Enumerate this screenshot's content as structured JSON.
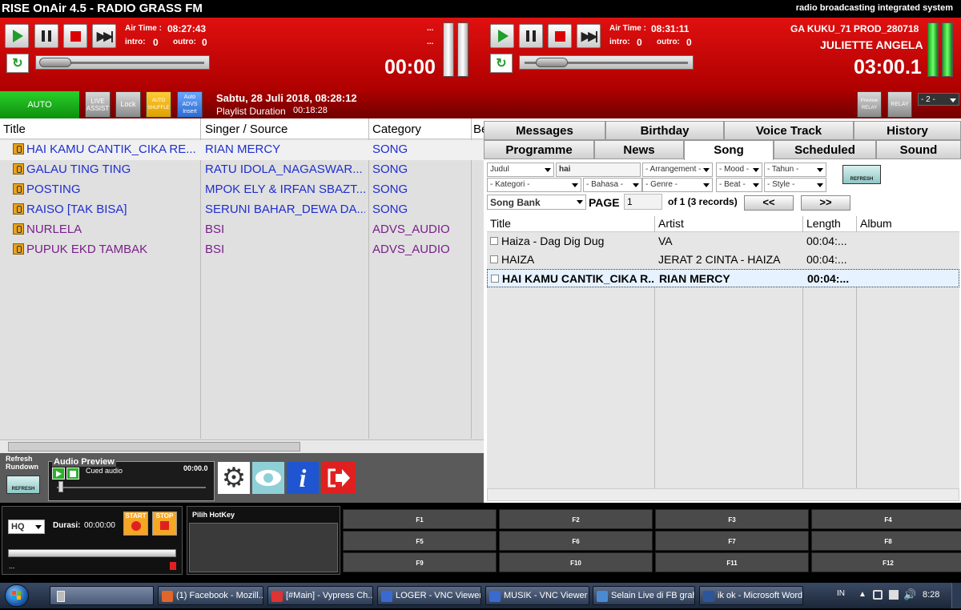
{
  "app": {
    "title": "RISE OnAir 4.5 - RADIO GRASS FM",
    "tagline": "radio broadcasting integrated system"
  },
  "player1": {
    "air_time_label": "Air Time :",
    "air_time": "08:27:43",
    "intro_label": "intro:",
    "intro": "0",
    "outro_label": "outro:",
    "outro": "0",
    "dots1": "...",
    "dots2": "...",
    "time": "00:00"
  },
  "player2": {
    "air_time_label": "Air Time :",
    "air_time": "08:31:11",
    "intro_label": "intro:",
    "intro": "0",
    "outro_label": "outro:",
    "outro": "0",
    "track_title": "GA KUKU_71 PROD_280718",
    "artist": "JULIETTE ANGELA",
    "time": "03:00.1"
  },
  "modes": {
    "auto": "AUTO",
    "live_assist_1": "LIVE",
    "live_assist_2": "ASSIST",
    "lock": "Lock",
    "auto_shuffle_1": "AUTO",
    "auto_shuffle_2": "SHUFFLE",
    "auto_advs_1": "Auto",
    "auto_advs_2": "ADVS",
    "auto_advs_3": "Insert"
  },
  "status": {
    "datetime": "Sabtu, 28 Juli 2018, 08:28:12",
    "playlist_label": "Playlist Duration",
    "playlist_duration": "00:18:28"
  },
  "relay": {
    "preview_1": "Preview",
    "preview_2": "RELAY",
    "relay": "RELAY",
    "channel": "- 2 -"
  },
  "playlist": {
    "columns": [
      "Title",
      "Singer / Source",
      "Category",
      "Be"
    ],
    "rows": [
      {
        "title": "HAI KAMU CANTIK_CIKA RE...",
        "singer": "RIAN MERCY",
        "category": "SONG",
        "color": "#1f2ed0"
      },
      {
        "title": "GALAU TING TING",
        "singer": "RATU IDOLA_NAGASWAR...",
        "category": "SONG",
        "color": "#1f2ed0"
      },
      {
        "title": "POSTING",
        "singer": "MPOK ELY & IRFAN SBAZT...",
        "category": "SONG",
        "color": "#1f2ed0"
      },
      {
        "title": "RAISO [TAK BISA]",
        "singer": "SERUNI BAHAR_DEWA DA...",
        "category": "SONG",
        "color": "#1f2ed0"
      },
      {
        "title": "NURLELA",
        "singer": "BSI",
        "category": "ADVS_AUDIO",
        "color": "#7a1f8a"
      },
      {
        "title": "PUPUK EKD TAMBAK",
        "singer": "BSI",
        "category": "ADVS_AUDIO",
        "color": "#7a1f8a"
      }
    ]
  },
  "tabs_row1": [
    "Messages",
    "Birthday",
    "Voice Track",
    "History"
  ],
  "tabs_row2": [
    "Programme",
    "News",
    "Song",
    "Scheduled",
    "Sound"
  ],
  "filters": {
    "judul": "Judul",
    "search": "hai",
    "arrangement": "- Arrangement -",
    "mood": "- Mood -",
    "tahun": "- Tahun -",
    "kategori": "- Kategori -",
    "bahasa": "- Bahasa -",
    "genre": "- Genre -",
    "beat": "- Beat -",
    "style": "- Style -",
    "refresh": "REFRESH"
  },
  "bank": {
    "source": "Song Bank",
    "page_label": "PAGE",
    "page": "1",
    "of": "of 1 (3 records)",
    "prev": "<<",
    "next": ">>"
  },
  "songs": {
    "columns": [
      "Title",
      "Artist",
      "Length",
      "Album"
    ],
    "rows": [
      {
        "title": "Haiza - Dag Dig Dug",
        "artist": "VA",
        "length": "00:04:..."
      },
      {
        "title": "HAIZA",
        "artist": "JERAT 2 CINTA - HAIZA",
        "length": "00:04:..."
      },
      {
        "title": "HAI KAMU CANTIK_CIKA R...",
        "artist": "RIAN MERCY",
        "length": "00:04:..."
      }
    ]
  },
  "bottom": {
    "refresh_1": "Refresh",
    "refresh_2": "Rundown",
    "refresh_btn": "REFRESH",
    "preview_title": "Audio Preview",
    "cued": "Cued audio",
    "cued_time": "00:00.0"
  },
  "recorder": {
    "quality": "HQ",
    "durasi_label": "Durasi:",
    "durasi": "00:00:00",
    "start": "START",
    "stop": "STOP",
    "dots": "...",
    "hotkey_label": "Pilih HotKey"
  },
  "fkeys": [
    "F1",
    "F2",
    "F3",
    "F4",
    "F5",
    "F6",
    "F7",
    "F8",
    "F9",
    "F10",
    "F11",
    "F12"
  ],
  "taskbar": {
    "tasks": [
      {
        "label": "(1) Facebook - Mozill...",
        "color": "#e0662a"
      },
      {
        "label": "[#Main] - Vypress Ch...",
        "color": "#d33"
      },
      {
        "label": "LOGER - VNC Viewer",
        "color": "#3a6ad0"
      },
      {
        "label": "MUSIK - VNC Viewer",
        "color": "#3a6ad0"
      },
      {
        "label": "Selain Live di FB grah...",
        "color": "#4a8ad0"
      },
      {
        "label": "ik ok - Microsoft Word",
        "color": "#2b579a"
      }
    ],
    "lang": "IN",
    "clock": "8:28"
  }
}
